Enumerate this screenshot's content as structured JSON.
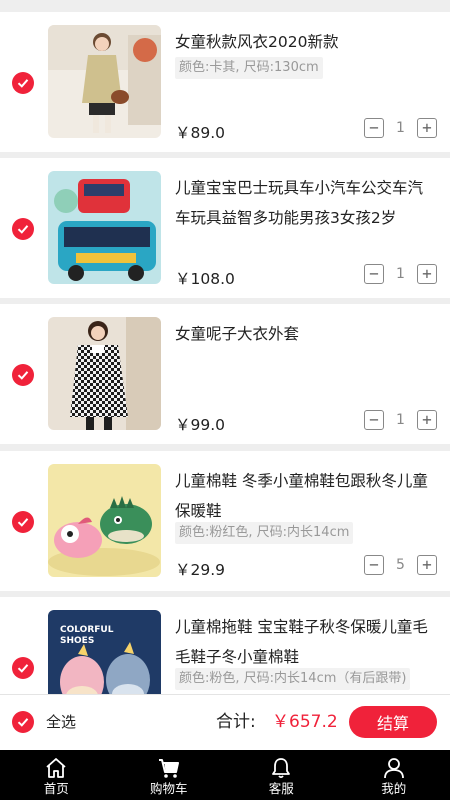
{
  "cart": {
    "items": [
      {
        "title": "女童秋款风衣2020新款",
        "spec": "颜色:卡其, 尺码:130cm",
        "price": "￥89.0",
        "qty": "1",
        "selected": true
      },
      {
        "title": "儿童宝宝巴士玩具车小汽车公交车汽车玩具益智多功能男孩3女孩2岁",
        "spec": "",
        "price": "￥108.0",
        "qty": "1",
        "selected": true
      },
      {
        "title": "女童呢子大衣外套",
        "spec": "",
        "price": "￥99.0",
        "qty": "1",
        "selected": true
      },
      {
        "title": "儿童棉鞋 冬季小童棉鞋包跟秋冬儿童保暖鞋",
        "spec": "颜色:粉红色, 尺码:内长14cm",
        "price": "￥29.9",
        "qty": "5",
        "selected": true
      },
      {
        "title": "儿童棉拖鞋 宝宝鞋子秋冬保暖儿童毛毛鞋子冬小童棉鞋",
        "spec": "颜色:粉色, 尺码:内长14cm（有后跟带)",
        "price": "",
        "qty": "",
        "selected": true
      }
    ],
    "minus_symbol": "−",
    "plus_symbol": "+"
  },
  "image_texts": {
    "shoes_brand": "COLORFUL",
    "shoes_word": "SHOES"
  },
  "summary": {
    "select_all_label": "全选",
    "total_label": "合计:",
    "total_value": "￥657.2",
    "checkout_label": "结算"
  },
  "tabbar": {
    "tabs": [
      {
        "label": "首页",
        "icon": "home-icon"
      },
      {
        "label": "购物车",
        "icon": "cart-icon"
      },
      {
        "label": "客服",
        "icon": "bell-icon"
      },
      {
        "label": "我的",
        "icon": "user-icon"
      }
    ]
  },
  "colors": {
    "accent": "#f0223a",
    "tabbar_bg": "#000000",
    "page_bg": "#eeeeee"
  }
}
